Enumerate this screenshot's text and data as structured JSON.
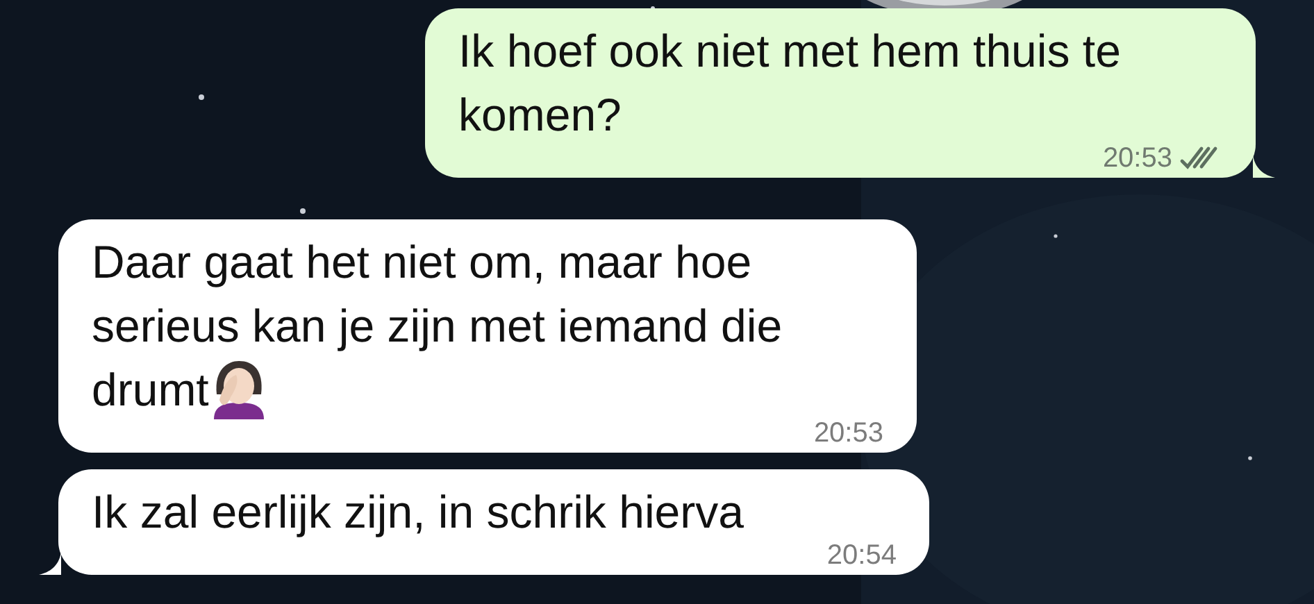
{
  "messages": [
    {
      "kind": "outgoing",
      "text": "Ik hoef ook niet met hem thuis te komen?",
      "time": "20:53",
      "read": false,
      "tail": true,
      "emoji": false
    },
    {
      "kind": "incoming",
      "text": "Daar gaat het niet om, maar hoe serieus kan je zijn met iemand die drumt",
      "time": "20:53",
      "tail": false,
      "emoji": true
    },
    {
      "kind": "incoming",
      "text": "Ik zal eerlijk zijn, in schrik hierva",
      "time": "20:54",
      "tail": true,
      "emoji": false
    }
  ]
}
